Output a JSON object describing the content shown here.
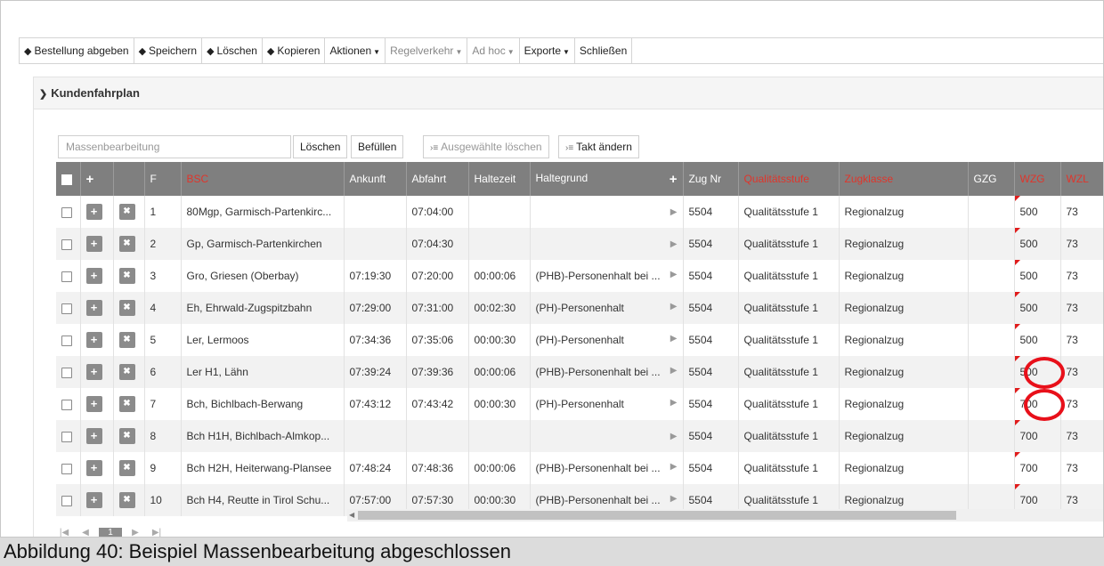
{
  "toolbar": {
    "items": [
      {
        "label": "Bestellung abgeben",
        "icon": "tag-icon",
        "dim": false
      },
      {
        "label": "Speichern",
        "icon": "tag-icon",
        "dim": false
      },
      {
        "label": "Löschen",
        "icon": "tag-icon",
        "dim": false
      },
      {
        "label": "Kopieren",
        "icon": "tag-icon",
        "dim": false
      },
      {
        "label": "Aktionen",
        "dropdown": true,
        "dim": false
      },
      {
        "label": "Regelverkehr",
        "dropdown": true,
        "dim": true
      },
      {
        "label": "Ad hoc",
        "dropdown": true,
        "dim": true
      },
      {
        "label": "Exporte",
        "dropdown": true,
        "dim": false
      },
      {
        "label": "Schließen",
        "dim": false
      }
    ]
  },
  "panel": {
    "title": "Kundenfahrplan"
  },
  "mass_edit": {
    "placeholder": "Massenbearbeitung",
    "delete_label": "Löschen",
    "fill_label": "Befüllen",
    "delete_selected_label": "Ausgewählte löschen",
    "change_takt_label": "Takt ändern"
  },
  "grid": {
    "headers": {
      "add": "+",
      "f": "F",
      "bsc": "BSC",
      "ankunft": "Ankunft",
      "abfahrt": "Abfahrt",
      "haltezeit": "Haltezeit",
      "haltegrund": "Haltegrund",
      "zugnr": "Zug Nr",
      "qualitaet": "Qualitätsstufe",
      "zugklasse": "Zugklasse",
      "gzg": "GZG",
      "wzg": "WZG",
      "wzl": "WZL"
    },
    "rows": [
      {
        "f": "1",
        "bsc": "80Mgp, Garmisch-Partenkirc...",
        "ankunft": "",
        "abfahrt": "07:04:00",
        "haltezeit": "",
        "haltegrund": "",
        "zugnr": "5504",
        "qualitaet": "Qualitätsstufe 1",
        "zugklasse": "Regionalzug",
        "gzg": "",
        "wzg": "500",
        "wzl": "73"
      },
      {
        "f": "2",
        "bsc": "Gp, Garmisch-Partenkirchen",
        "ankunft": "",
        "abfahrt": "07:04:30",
        "haltezeit": "",
        "haltegrund": "",
        "zugnr": "5504",
        "qualitaet": "Qualitätsstufe 1",
        "zugklasse": "Regionalzug",
        "gzg": "",
        "wzg": "500",
        "wzl": "73"
      },
      {
        "f": "3",
        "bsc": "Gro, Griesen (Oberbay)",
        "ankunft": "07:19:30",
        "abfahrt": "07:20:00",
        "haltezeit": "00:00:06",
        "haltegrund": "(PHB)-Personenhalt bei ...",
        "zugnr": "5504",
        "qualitaet": "Qualitätsstufe 1",
        "zugklasse": "Regionalzug",
        "gzg": "",
        "wzg": "500",
        "wzl": "73"
      },
      {
        "f": "4",
        "bsc": "Eh, Ehrwald-Zugspitzbahn",
        "ankunft": "07:29:00",
        "abfahrt": "07:31:00",
        "haltezeit": "00:02:30",
        "haltegrund": "(PH)-Personenhalt",
        "zugnr": "5504",
        "qualitaet": "Qualitätsstufe 1",
        "zugklasse": "Regionalzug",
        "gzg": "",
        "wzg": "500",
        "wzl": "73"
      },
      {
        "f": "5",
        "bsc": "Ler, Lermoos",
        "ankunft": "07:34:36",
        "abfahrt": "07:35:06",
        "haltezeit": "00:00:30",
        "haltegrund": "(PH)-Personenhalt",
        "zugnr": "5504",
        "qualitaet": "Qualitätsstufe 1",
        "zugklasse": "Regionalzug",
        "gzg": "",
        "wzg": "500",
        "wzl": "73"
      },
      {
        "f": "6",
        "bsc": "Ler H1, Lähn",
        "ankunft": "07:39:24",
        "abfahrt": "07:39:36",
        "haltezeit": "00:00:06",
        "haltegrund": "(PHB)-Personenhalt bei ...",
        "zugnr": "5504",
        "qualitaet": "Qualitätsstufe 1",
        "zugklasse": "Regionalzug",
        "gzg": "",
        "wzg": "500",
        "wzl": "73"
      },
      {
        "f": "7",
        "bsc": "Bch, Bichlbach-Berwang",
        "ankunft": "07:43:12",
        "abfahrt": "07:43:42",
        "haltezeit": "00:00:30",
        "haltegrund": "(PH)-Personenhalt",
        "zugnr": "5504",
        "qualitaet": "Qualitätsstufe 1",
        "zugklasse": "Regionalzug",
        "gzg": "",
        "wzg": "700",
        "wzl": "73"
      },
      {
        "f": "8",
        "bsc": "Bch H1H, Bichlbach-Almkop...",
        "ankunft": "",
        "abfahrt": "",
        "haltezeit": "",
        "haltegrund": "",
        "zugnr": "5504",
        "qualitaet": "Qualitätsstufe 1",
        "zugklasse": "Regionalzug",
        "gzg": "",
        "wzg": "700",
        "wzl": "73"
      },
      {
        "f": "9",
        "bsc": "Bch H2H, Heiterwang-Plansee",
        "ankunft": "07:48:24",
        "abfahrt": "07:48:36",
        "haltezeit": "00:00:06",
        "haltegrund": "(PHB)-Personenhalt bei ...",
        "zugnr": "5504",
        "qualitaet": "Qualitätsstufe 1",
        "zugklasse": "Regionalzug",
        "gzg": "",
        "wzg": "700",
        "wzl": "73"
      },
      {
        "f": "10",
        "bsc": "Bch H4, Reutte in Tirol Schu...",
        "ankunft": "07:57:00",
        "abfahrt": "07:57:30",
        "haltezeit": "00:00:30",
        "haltegrund": "(PHB)-Personenhalt bei ...",
        "zugnr": "5504",
        "qualitaet": "Qualitätsstufe 1",
        "zugklasse": "Regionalzug",
        "gzg": "",
        "wzg": "700",
        "wzl": "73"
      }
    ]
  },
  "pager": {
    "current": "1"
  },
  "caption": "Abbildung 40: Beispiel Massenbearbeitung abgeschlossen",
  "colors": {
    "header_bg": "#7f7f7f",
    "header_red": "#e0352b",
    "highlight_circle": "#e8101a"
  }
}
